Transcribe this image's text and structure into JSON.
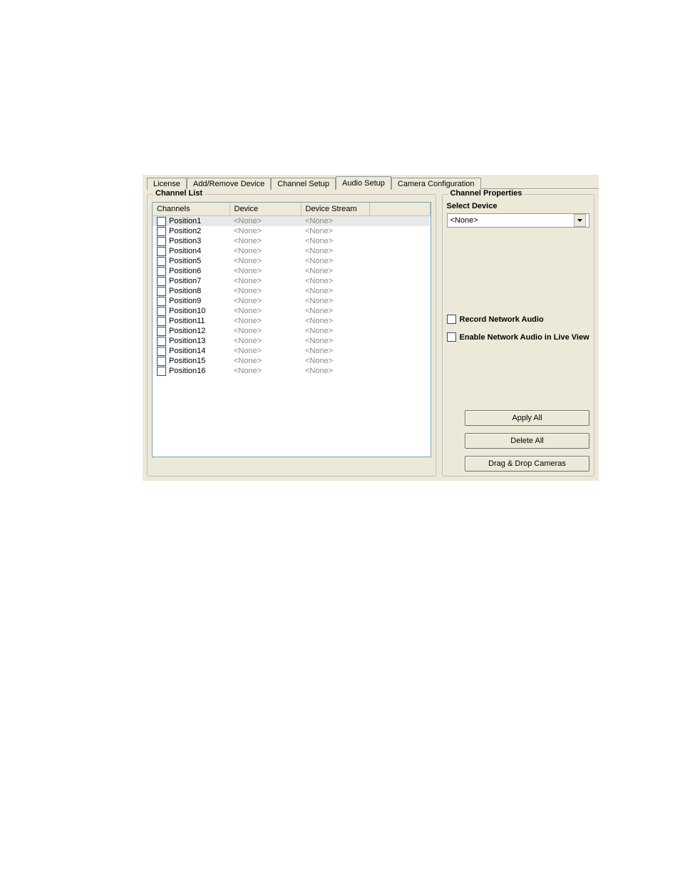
{
  "tabs": {
    "items": [
      {
        "label": "License"
      },
      {
        "label": "Add/Remove Device"
      },
      {
        "label": "Channel Setup"
      },
      {
        "label": "Audio Setup"
      },
      {
        "label": "Camera Configuration"
      }
    ],
    "active_index": 3
  },
  "channel_list": {
    "title": "Channel List",
    "headers": {
      "channels": "Channels",
      "device": "Device",
      "stream": "Device Stream"
    },
    "rows": [
      {
        "name": "Position1",
        "device": "<None>",
        "stream": "<None>",
        "selected": true
      },
      {
        "name": "Position2",
        "device": "<None>",
        "stream": "<None>",
        "selected": false
      },
      {
        "name": "Position3",
        "device": "<None>",
        "stream": "<None>",
        "selected": false
      },
      {
        "name": "Position4",
        "device": "<None>",
        "stream": "<None>",
        "selected": false
      },
      {
        "name": "Position5",
        "device": "<None>",
        "stream": "<None>",
        "selected": false
      },
      {
        "name": "Position6",
        "device": "<None>",
        "stream": "<None>",
        "selected": false
      },
      {
        "name": "Position7",
        "device": "<None>",
        "stream": "<None>",
        "selected": false
      },
      {
        "name": "Position8",
        "device": "<None>",
        "stream": "<None>",
        "selected": false
      },
      {
        "name": "Position9",
        "device": "<None>",
        "stream": "<None>",
        "selected": false
      },
      {
        "name": "Position10",
        "device": "<None>",
        "stream": "<None>",
        "selected": false
      },
      {
        "name": "Position11",
        "device": "<None>",
        "stream": "<None>",
        "selected": false
      },
      {
        "name": "Position12",
        "device": "<None>",
        "stream": "<None>",
        "selected": false
      },
      {
        "name": "Position13",
        "device": "<None>",
        "stream": "<None>",
        "selected": false
      },
      {
        "name": "Position14",
        "device": "<None>",
        "stream": "<None>",
        "selected": false
      },
      {
        "name": "Position15",
        "device": "<None>",
        "stream": "<None>",
        "selected": false
      },
      {
        "name": "Position16",
        "device": "<None>",
        "stream": "<None>",
        "selected": false
      }
    ]
  },
  "properties": {
    "title": "Channel Properties",
    "select_device_label": "Select Device",
    "select_device_value": "<None>",
    "record_label": "Record Network Audio",
    "enable_label": "Enable Network Audio in Live View",
    "buttons": {
      "apply_all": "Apply All",
      "delete_all": "Delete All",
      "drag_drop": "Drag & Drop Cameras"
    }
  }
}
